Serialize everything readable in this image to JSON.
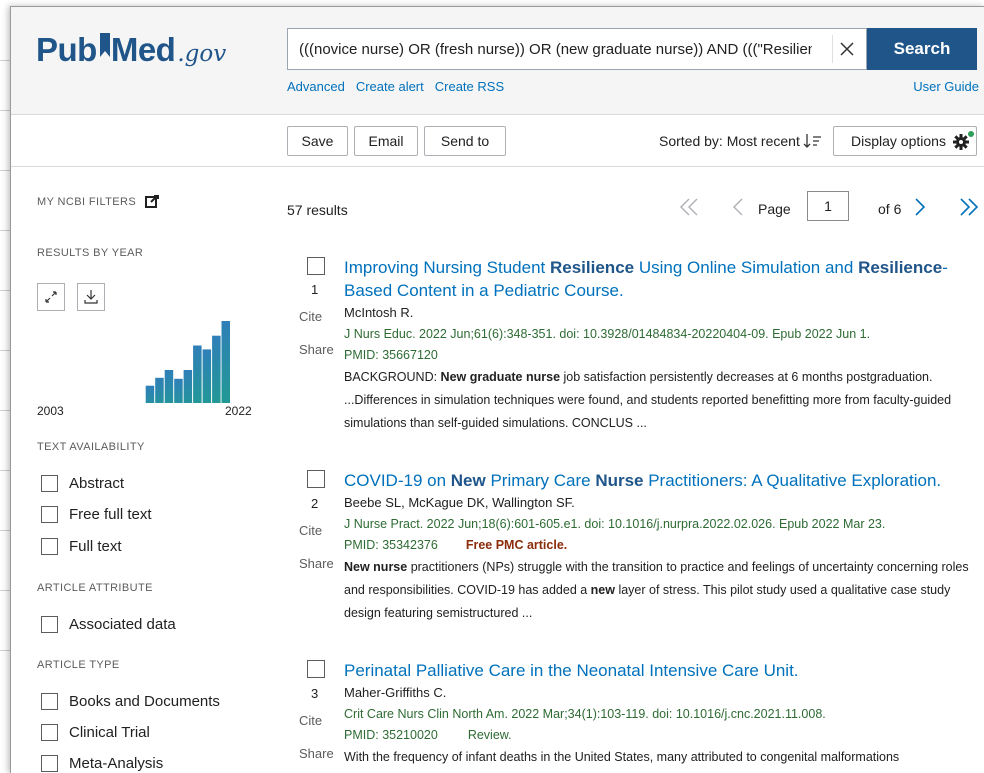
{
  "header": {
    "logo_pub": "Pub",
    "logo_med": "Med",
    "logo_gov": ".gov",
    "search_value": "(((novice nurse) OR (fresh nurse)) OR (new graduate nurse)) AND (((\"Resilienc",
    "search_button": "Search",
    "links": [
      "Advanced",
      "Create alert",
      "Create RSS"
    ],
    "user_guide": "User Guide"
  },
  "toolbar": {
    "save": "Save",
    "email": "Email",
    "send_to": "Send to",
    "sorted_by": "Sorted by: Most recent",
    "display_options": "Display options"
  },
  "sidebar": {
    "my_ncbi_filters": "MY NCBI FILTERS",
    "results_by_year": "RESULTS BY YEAR",
    "year_start": "2003",
    "year_end": "2022",
    "text_availability": "TEXT AVAILABILITY",
    "text_filters": [
      "Abstract",
      "Free full text",
      "Full text"
    ],
    "article_attribute": "ARTICLE ATTRIBUTE",
    "attribute_filters": [
      "Associated data"
    ],
    "article_type": "ARTICLE TYPE",
    "type_filters": [
      "Books and Documents",
      "Clinical Trial",
      "Meta-Analysis"
    ],
    "year_histogram": [
      0.02,
      0.02,
      0.02,
      0.02,
      0.02,
      0.02,
      0.02,
      0.02,
      0.09,
      0.09,
      0.34,
      0.42,
      0.5,
      0.41,
      0.5,
      0.75,
      0.71,
      0.85,
      1.0
    ]
  },
  "results": {
    "count": "57 results",
    "page_label": "Page",
    "page_value": "1",
    "of_pages": "of 6",
    "cite_label": "Cite",
    "share_label": "Share",
    "items": [
      {
        "num": "1",
        "title": [
          {
            "t": "Improving Nursing Student ",
            "b": false
          },
          {
            "t": "Resilience",
            "b": true
          },
          {
            "t": " Using Online Simulation and ",
            "b": false
          },
          {
            "t": "Resilience",
            "b": true
          },
          {
            "t": "-Based Content in a Pediatric Course.",
            "b": false
          }
        ],
        "authors": "McIntosh R.",
        "citation": "J Nurs Educ. 2022 Jun;61(6):348-351. doi: 10.3928/01484834-20220404-09. Epub 2022 Jun 1.",
        "pmid": "PMID: 35667120",
        "tag": "",
        "snippet": [
          {
            "t": "BACKGROUND: ",
            "b": false
          },
          {
            "t": "New graduate nurse",
            "b": true
          },
          {
            "t": " job satisfaction persistently decreases at 6 months postgraduation. ...Differences in simulation techniques were found, and students reported benefitting more from faculty-guided simulations than self-guided simulations. CONCLUS ...",
            "b": false
          }
        ]
      },
      {
        "num": "2",
        "title": [
          {
            "t": "COVID-19 on ",
            "b": false
          },
          {
            "t": "New",
            "b": true
          },
          {
            "t": " Primary Care ",
            "b": false
          },
          {
            "t": "Nurse",
            "b": true
          },
          {
            "t": " Practitioners: A Qualitative Exploration.",
            "b": false
          }
        ],
        "authors": "Beebe SL, McKague DK, Wallington SF.",
        "citation": "J Nurse Pract. 2022 Jun;18(6):601-605.e1. doi: 10.1016/j.nurpra.2022.02.026. Epub 2022 Mar 23.",
        "pmid": "PMID: 35342376",
        "tag": "Free PMC article.",
        "snippet": [
          {
            "t": "New nurse",
            "b": true
          },
          {
            "t": " practitioners (NPs) struggle with the transition to practice and feelings of uncertainty concerning roles and responsibilities. COVID-19 has added a ",
            "b": false
          },
          {
            "t": "new",
            "b": true
          },
          {
            "t": " layer of stress. This pilot study used a qualitative case study design featuring semistructured ...",
            "b": false
          }
        ]
      },
      {
        "num": "3",
        "title": [
          {
            "t": "Perinatal Palliative Care in the Neonatal Intensive Care Unit.",
            "b": false
          }
        ],
        "authors": "Maher-Griffiths C.",
        "citation": "Crit Care Nurs Clin North Am. 2022 Mar;34(1):103-119. doi: 10.1016/j.cnc.2021.11.008.",
        "pmid": "PMID: 35210020",
        "tag": "Review.",
        "snippet": [
          {
            "t": "With the frequency of infant deaths in the United States, many attributed to congenital malformations",
            "b": false
          }
        ]
      }
    ]
  },
  "colors": {
    "brand": "#20558a",
    "link": "#0071bc",
    "citation": "#2e6b33",
    "histogram": "#1f9e8f"
  }
}
